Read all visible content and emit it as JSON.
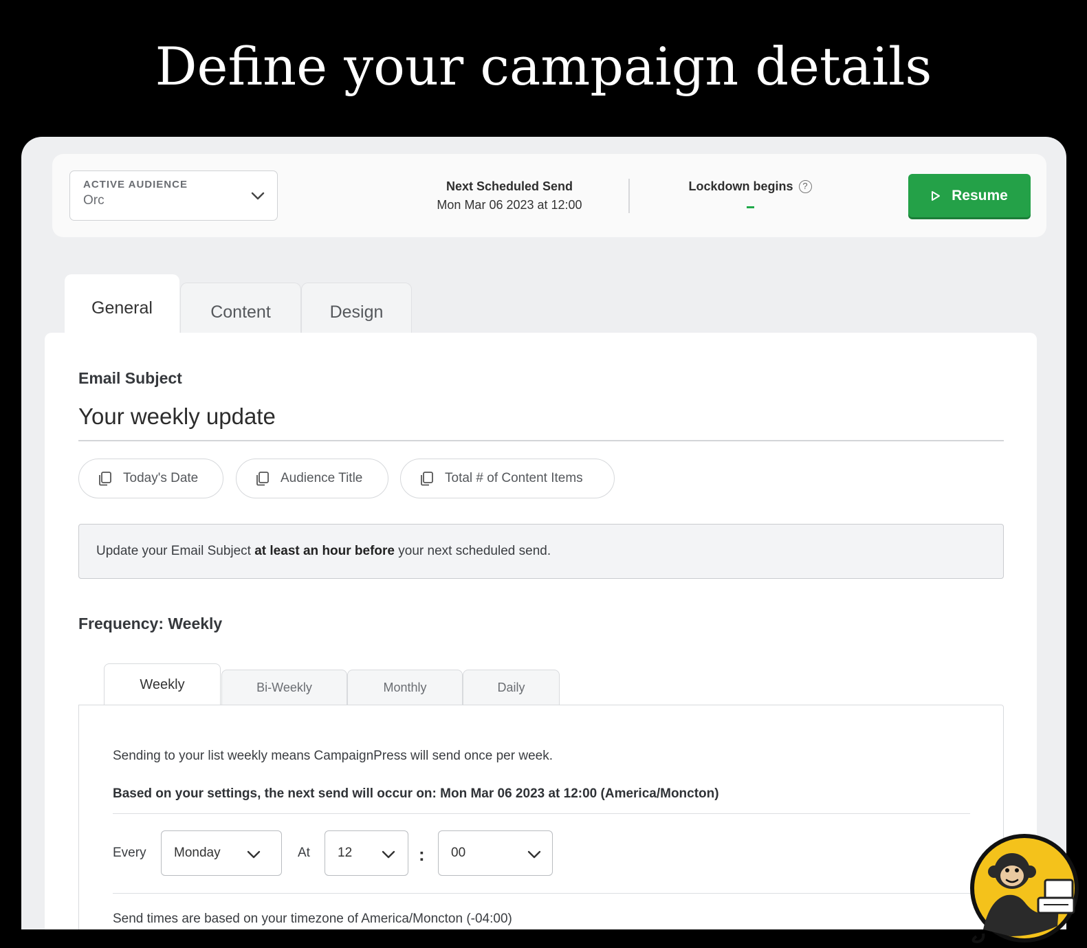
{
  "hero": {
    "title": "Define your campaign details"
  },
  "topbar": {
    "audience_label": "ACTIVE AUDIENCE",
    "audience_value": "Orc",
    "next_send_label": "Next Scheduled Send",
    "next_send_value": "Mon Mar 06 2023 at 12:00",
    "lockdown_label": "Lockdown begins",
    "resume_label": "Resume"
  },
  "tabs": [
    {
      "label": "General",
      "active": true
    },
    {
      "label": "Content",
      "active": false
    },
    {
      "label": "Design",
      "active": false
    }
  ],
  "general": {
    "subject_label": "Email Subject",
    "subject_value": "Your weekly update",
    "chips": [
      "Today's Date",
      "Audience Title",
      "Total # of Content Items"
    ],
    "notice": {
      "before": "Update your Email Subject ",
      "bold": "at least an hour before",
      "after": " your next scheduled send."
    },
    "frequency_label": "Frequency: Weekly"
  },
  "frequency": {
    "tabs": [
      {
        "label": "Weekly",
        "active": true
      },
      {
        "label": "Bi-Weekly",
        "active": false
      },
      {
        "label": "Monthly",
        "active": false
      },
      {
        "label": "Daily",
        "active": false
      }
    ],
    "description": "Sending to your list weekly means CampaignPress will send once per week.",
    "next_send": "Based on your settings, the next send will occur on: Mon Mar 06 2023 at 12:00 (America/Moncton)",
    "every_label": "Every",
    "day_value": "Monday",
    "at_label": "At",
    "hour_value": "12",
    "colon": ":",
    "minute_value": "00",
    "timezone_note": "Send times are based on your timezone of America/Moncton (-04:00)"
  },
  "colors": {
    "accent_green": "#24a148",
    "background": "#000000"
  },
  "icons": [
    "chevron-down-icon",
    "help-icon",
    "play-icon",
    "copy-icon",
    "monkey-mascot-icon"
  ]
}
